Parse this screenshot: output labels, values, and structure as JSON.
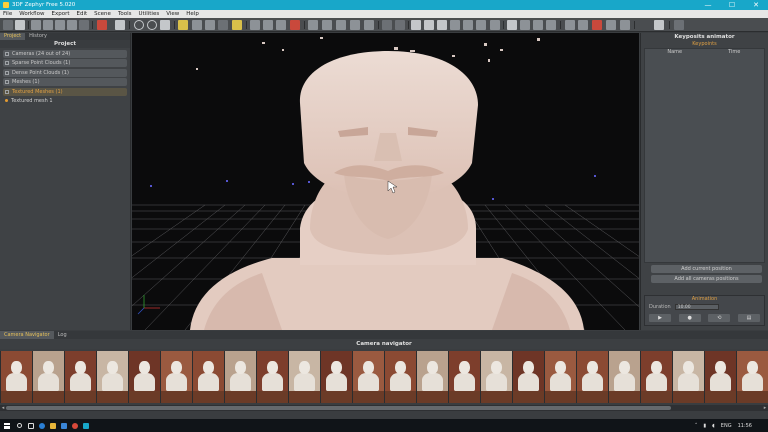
{
  "window": {
    "title": "3DF Zephyr Free 5.020",
    "controls": [
      "—",
      "☐",
      "✕"
    ]
  },
  "menu": [
    "File",
    "Workflow",
    "Export",
    "Edit",
    "Scene",
    "Tools",
    "Utilities",
    "View",
    "Help"
  ],
  "left_panel": {
    "tabs": [
      "Project",
      "History"
    ],
    "active_tab": "Project",
    "heading": "Project",
    "items": [
      {
        "label": "Cameras (24 out of 24)",
        "highlighted": false
      },
      {
        "label": "Sparse Point Clouds (1)",
        "highlighted": false
      },
      {
        "label": "Dense Point Clouds (1)",
        "highlighted": false
      },
      {
        "label": "Meshes (1)",
        "highlighted": false
      },
      {
        "label": "Textured Meshes (1)",
        "highlighted": true
      }
    ],
    "subitem": "Textured mesh 1"
  },
  "right_panel": {
    "title": "Keyposits animator",
    "section": "Keypoints",
    "columns": [
      "Name",
      "Time"
    ],
    "buttons": [
      "Add current position",
      "Add all cameras positions"
    ],
    "animation": {
      "title": "Animation",
      "duration_label": "Duration",
      "duration_value": "10.00",
      "controls": [
        "▶",
        "●",
        "⟲",
        "▤"
      ]
    }
  },
  "bottom_panel": {
    "tabs": [
      "Camera Navigator",
      "Log"
    ],
    "active_tab": "Camera Navigator",
    "title": "Camera navigator",
    "thumbnail_count": 24
  },
  "taskbar": {
    "language": "ENG",
    "time": "11:56"
  },
  "colors": {
    "titlebar": "#18a7c9",
    "accent": "#e0a044",
    "panel": "#3f4245",
    "viewport_bg": "#0b0b0c",
    "bust": "#e9ddd6"
  }
}
